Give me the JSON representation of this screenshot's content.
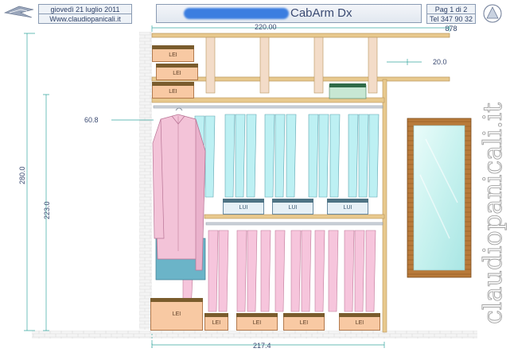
{
  "header": {
    "date": "giovedì 21 luglio 2011",
    "website": "Www.claudiopanicali.it",
    "title": "CabArm Dx",
    "page": "Pag 1 di 2",
    "phone": "Tel 347 90 32 878"
  },
  "watermark": "claudiopanicali.it",
  "dimensions": {
    "top_width": "220.00",
    "shelf_gap": "20.0",
    "rail_height": "60.8",
    "total_height": "280.0",
    "inner_height": "223.0",
    "bottom_width": "217.4"
  },
  "boxes": {
    "lei_label": "LEI",
    "lui_label": "LUI"
  },
  "colors": {
    "wood": "#e8c98e",
    "wood_edge": "#b8955a",
    "shirt_cyan": "#bdf0f3",
    "shirt_pink": "#f6c5dc",
    "box_orange": "#f8c9a3",
    "accent_blue": "#3c7ee0"
  }
}
